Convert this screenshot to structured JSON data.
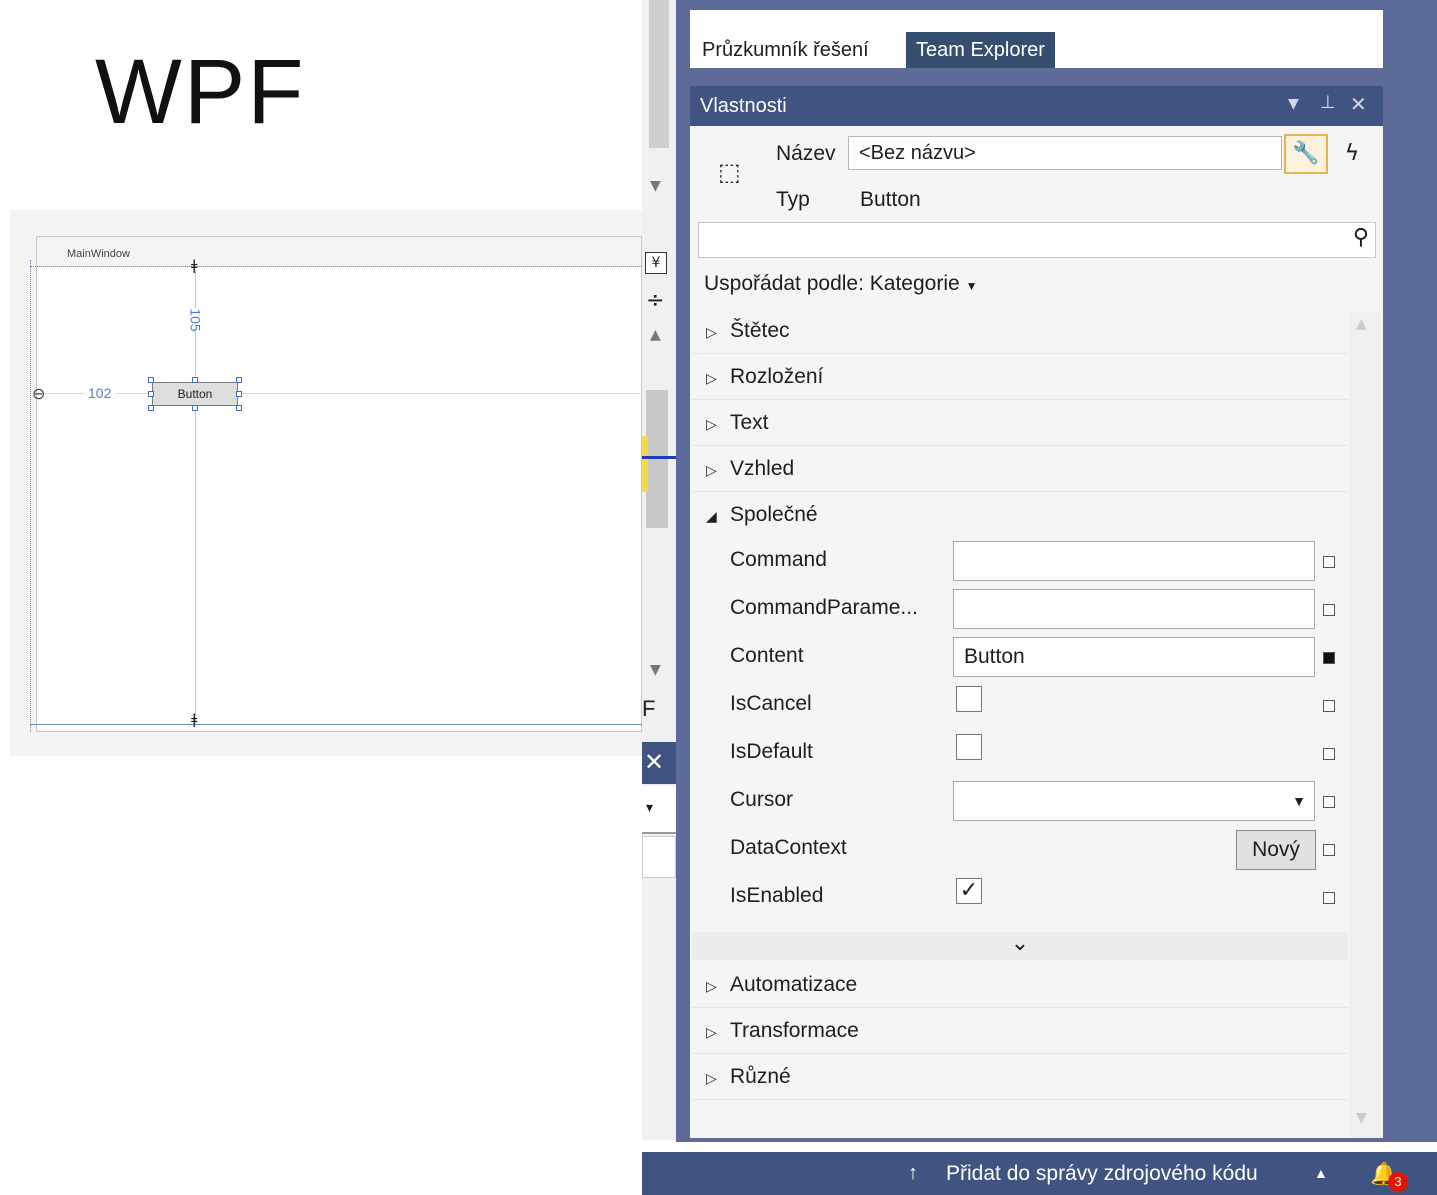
{
  "slide": {
    "title": "WPF"
  },
  "designer": {
    "window_title": "MainWindow",
    "button_label": "Button",
    "top_margin": "105",
    "left_margin": "102"
  },
  "strip": {
    "letter": "F"
  },
  "tabs": [
    {
      "label": "Průzkumník řešení"
    },
    {
      "label": "Team Explorer"
    }
  ],
  "properties": {
    "header": "Vlastnosti",
    "name_label": "Název",
    "name_value": "<Bez názvu>",
    "type_label": "Typ",
    "type_value": "Button",
    "arrange_by": "Uspořádat podle: Kategorie",
    "categories_top": [
      "Štětec",
      "Rozložení",
      "Text",
      "Vzhled"
    ],
    "expanded_category": "Společné",
    "common": {
      "command_label": "Command",
      "command_value": "",
      "commandparam_label": "CommandParame...",
      "commandparam_value": "",
      "content_label": "Content",
      "content_value": "Button",
      "iscancel_label": "IsCancel",
      "isdefault_label": "IsDefault",
      "cursor_label": "Cursor",
      "cursor_value": "",
      "datacontext_label": "DataContext",
      "datacontext_button": "Nový",
      "isenabled_label": "IsEnabled"
    },
    "categories_bottom": [
      "Automatizace",
      "Transformace",
      "Různé"
    ]
  },
  "status_bar": {
    "source_control": "Přidat do správy zdrojového kódu",
    "notification_count": "3"
  },
  "colors": {
    "accent": "#3f5480",
    "frame": "#5d6b99",
    "tab_active": "#364e6f"
  }
}
